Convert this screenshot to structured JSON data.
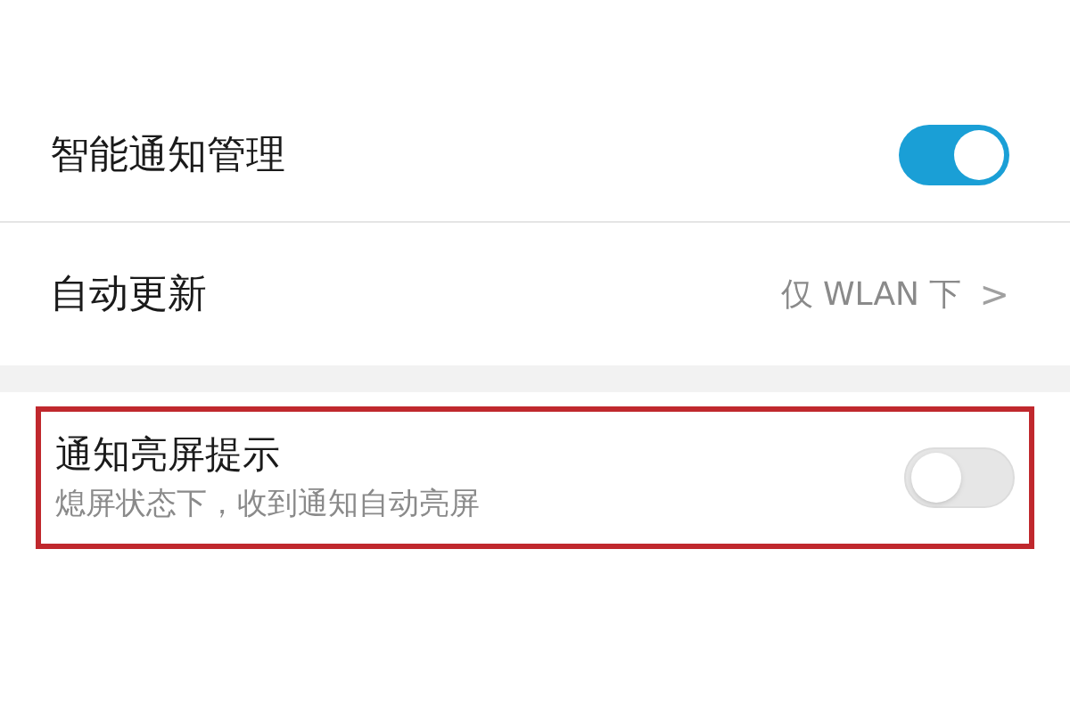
{
  "settings": [
    {
      "kind": "toggle",
      "title": "智能通知管理",
      "on": true
    },
    {
      "kind": "link",
      "title": "自动更新",
      "value": "仅 WLAN 下",
      "chevron": ">"
    }
  ],
  "notice": {
    "title": "通知亮屏提示",
    "subtitle": "熄屏状态下，收到通知自动亮屏",
    "on": false,
    "highlighted": true
  }
}
